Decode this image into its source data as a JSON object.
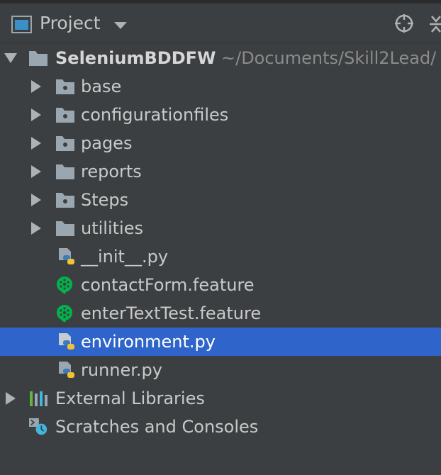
{
  "panel": {
    "title": "Project",
    "icons": [
      "project-window-icon",
      "dropdown-caret-icon",
      "locate-target-icon",
      "collapse-all-icon"
    ]
  },
  "tree": {
    "root": {
      "name": "SeleniumBDDFW",
      "path": "~/Documents/Skill2Lead/"
    },
    "folders": [
      {
        "name": "base"
      },
      {
        "name": "configurationfiles"
      },
      {
        "name": "pages"
      },
      {
        "name": "reports"
      },
      {
        "name": "Steps"
      },
      {
        "name": "utilities"
      }
    ],
    "files": [
      {
        "name": "__init__.py",
        "type": "python"
      },
      {
        "name": "contactForm.feature",
        "type": "cucumber"
      },
      {
        "name": "enterTextTest.feature",
        "type": "cucumber"
      },
      {
        "name": "environment.py",
        "type": "python",
        "selected": true
      },
      {
        "name": "runner.py",
        "type": "python"
      }
    ],
    "external_libraries": "External Libraries",
    "scratches": "Scratches and Consoles"
  },
  "colors": {
    "background": "#3c3f41",
    "selection": "#2f65ca",
    "text": "#c9c9c9",
    "path_text": "#8b8b8b",
    "cucumber": "#00b34a",
    "python_blue": "#3d7ab8",
    "python_yellow": "#f1c232"
  }
}
